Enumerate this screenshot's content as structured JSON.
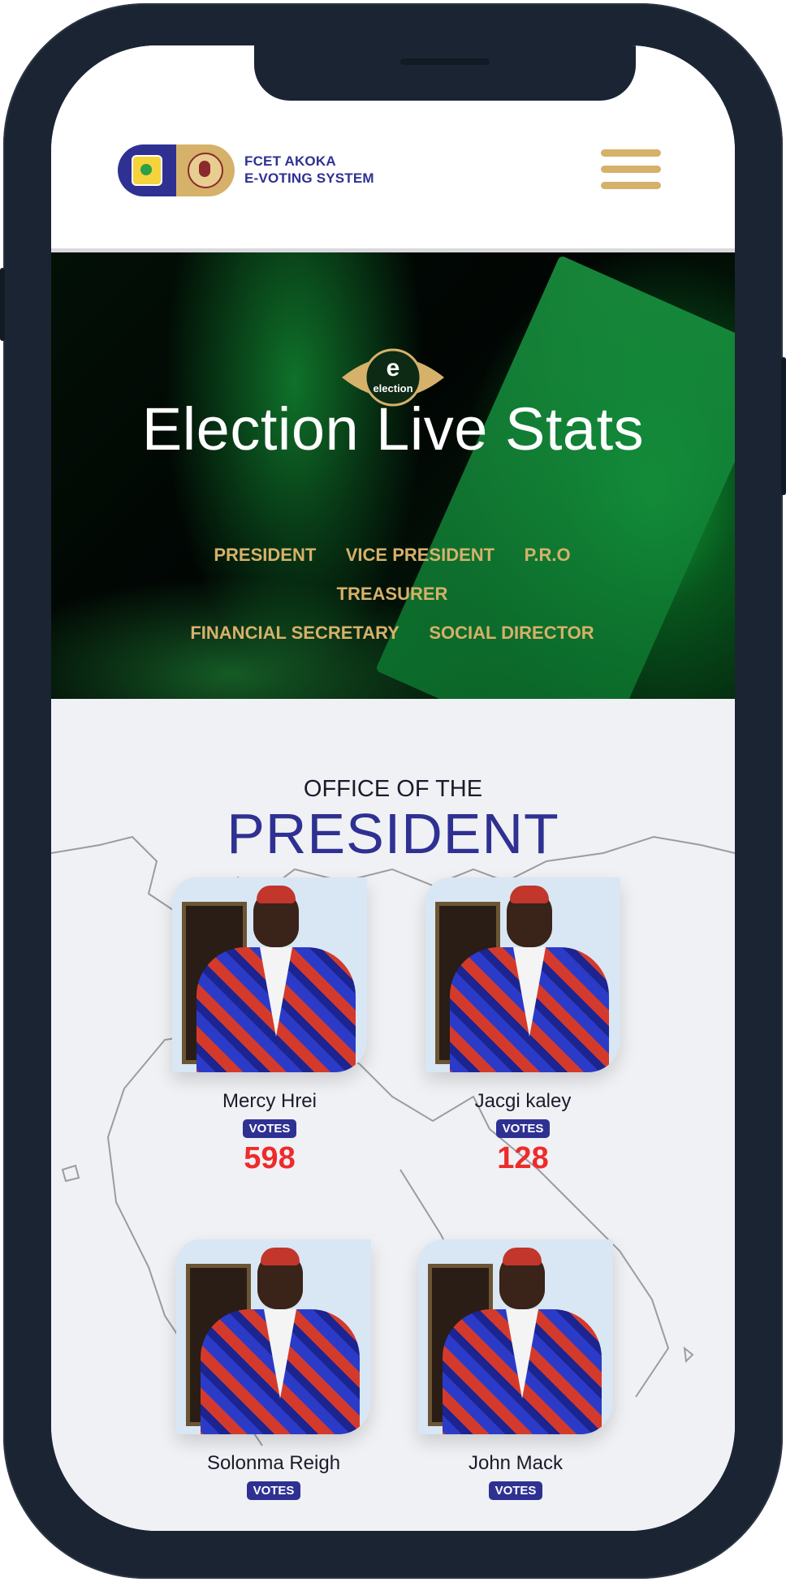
{
  "header": {
    "brand_line1": "FCET AKOKA",
    "brand_line2": "E-VOTING SYSTEM"
  },
  "hero": {
    "logo_text": "election",
    "logo_letter": "e",
    "title": "Election Live Stats",
    "offices": [
      "PRESIDENT",
      "VICE PRESIDENT",
      "P.R.O",
      "TREASURER",
      "FINANCIAL SECRETARY",
      "SOCIAL DIRECTOR"
    ]
  },
  "section": {
    "office_of": "OFFICE OF THE",
    "position": "PRESIDENT"
  },
  "candidates": [
    {
      "name": "Mercy Hrei",
      "votes_label": "VOTES",
      "votes": "598"
    },
    {
      "name": "Jacgi kaley",
      "votes_label": "VOTES",
      "votes": "128"
    },
    {
      "name": "Solonma Reigh",
      "votes_label": "VOTES",
      "votes": ""
    },
    {
      "name": "John Mack",
      "votes_label": "VOTES",
      "votes": ""
    }
  ],
  "colors": {
    "brand_blue": "#2e3192",
    "gold": "#d6b16a",
    "vote_red": "#ee2b2b",
    "frame": "#1b2433"
  }
}
